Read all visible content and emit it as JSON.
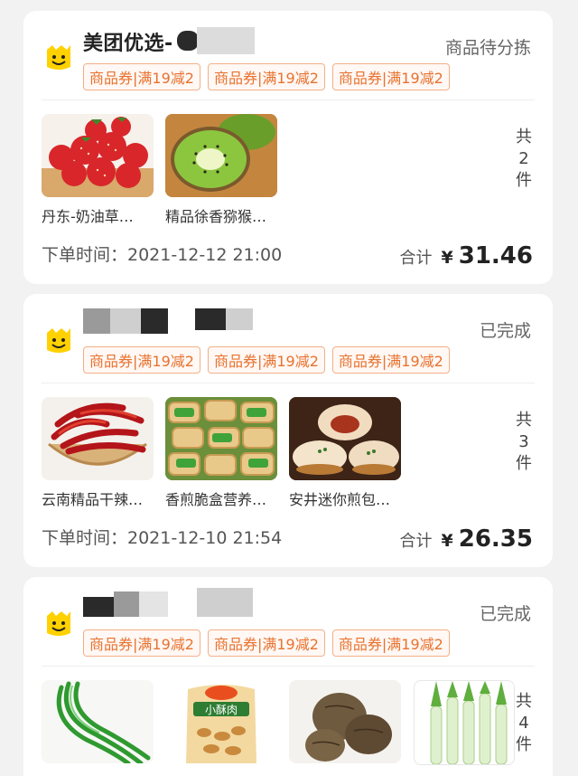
{
  "orders": [
    {
      "store": "美团优选-",
      "status": "商品待分拣",
      "tags": [
        "商品券|满19减2",
        "商品券|满19减2",
        "商品券|满19减2"
      ],
      "products": [
        {
          "name": "丹东-奶油草…",
          "image": "strawberry-image"
        },
        {
          "name": "精品徐香猕猴…",
          "image": "kiwi-image"
        }
      ],
      "count": [
        "共",
        "2",
        "件"
      ],
      "order_time": "下单时间：2021-12-12 21:00",
      "total_label": "合计",
      "currency": "¥",
      "total": "31.46"
    },
    {
      "store": "",
      "status": "已完成",
      "tags": [
        "商品券|满19减2",
        "商品券|满19减2",
        "商品券|满19减2"
      ],
      "products": [
        {
          "name": "云南精品干辣…",
          "image": "chili-image"
        },
        {
          "name": "香煎脆盒营养…",
          "image": "pancake-image"
        },
        {
          "name": "安井迷你煎包…",
          "image": "bun-image"
        }
      ],
      "count": [
        "共",
        "3",
        "件"
      ],
      "order_time": "下单时间：2021-12-10 21:54",
      "total_label": "合计",
      "currency": "¥",
      "total": "26.35"
    },
    {
      "store": "",
      "status": "已完成",
      "tags": [
        "商品券|满19减2",
        "商品券|满19减2",
        "商品券|满19减2"
      ],
      "products": [
        {
          "name": "",
          "image": "scallion-image"
        },
        {
          "name": "",
          "image": "snack-bag-image"
        },
        {
          "name": "",
          "image": "taro-image"
        },
        {
          "name": "",
          "image": "leek-image"
        }
      ],
      "count": [
        "共",
        "4",
        "件"
      ]
    }
  ],
  "colors": {
    "accent": "#e8722f",
    "tag_border": "#f2b08a",
    "logo_yellow": "#ffd100",
    "background": "#f2f2f2"
  }
}
